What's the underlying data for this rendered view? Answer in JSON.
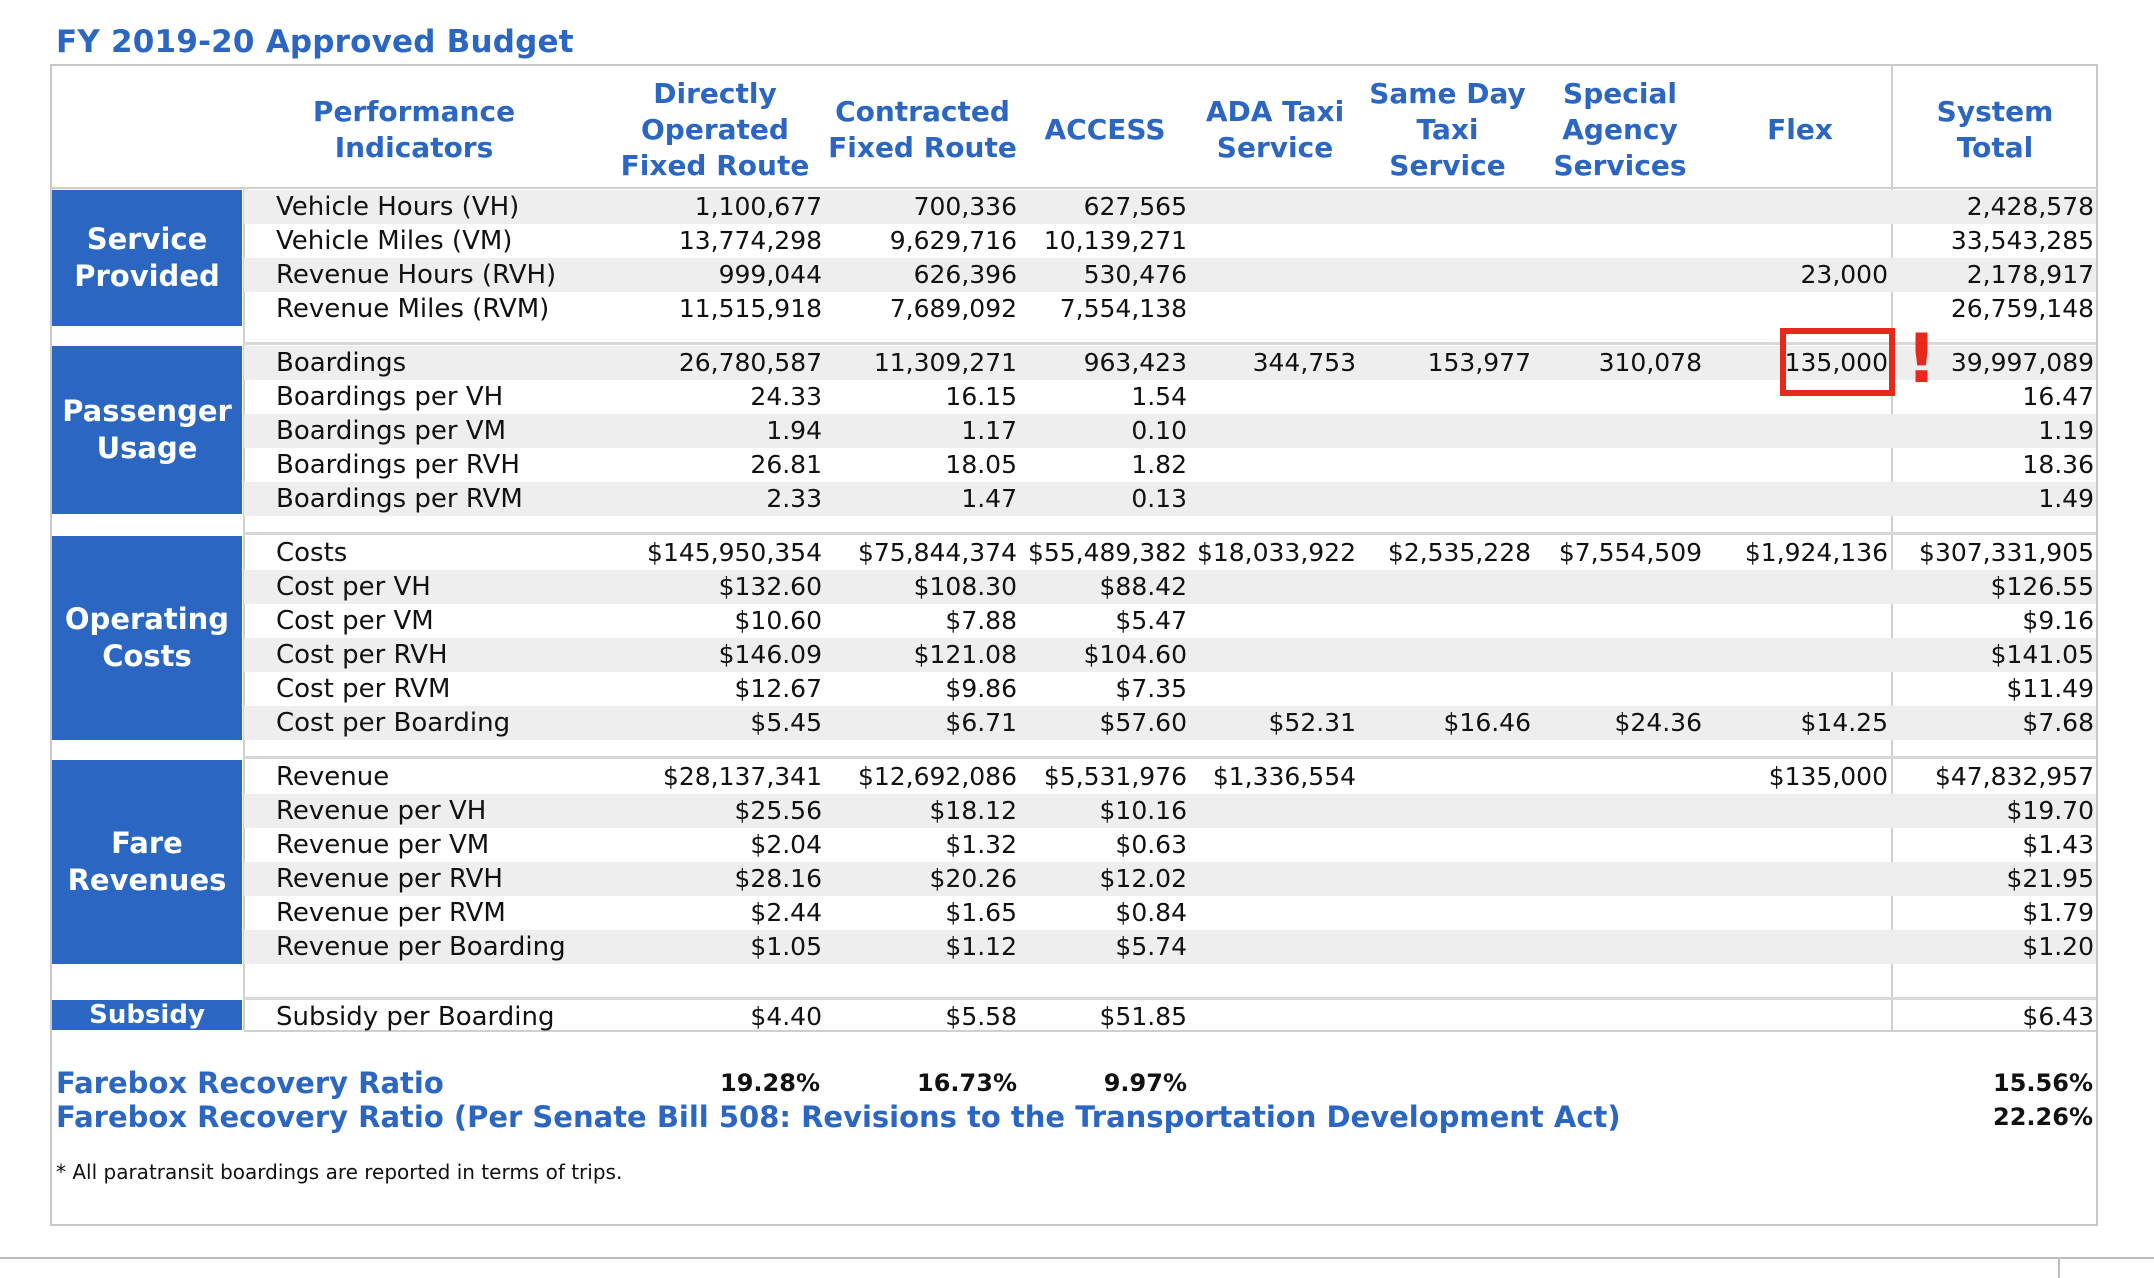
{
  "title": "FY 2019-20 Approved Budget",
  "headers": {
    "performance": "Performance Indicators",
    "direct": "Directly\nOperated\nFixed Route",
    "contracted": "Contracted\nFixed Route",
    "access": "ACCESS",
    "ada": "ADA Taxi\nService",
    "sameday": "Same Day\nTaxi\nService",
    "special": "Special\nAgency\nServices",
    "flex": "Flex",
    "total": "System Total"
  },
  "sections": {
    "service": "Service\nProvided",
    "passenger": "Passenger\nUsage",
    "operating": "Operating\nCosts",
    "fare": "Fare\nRevenues",
    "subsidy": "Subsidy"
  },
  "rows": [
    {
      "label": "Vehicle Hours (VH)",
      "direct": "1,100,677",
      "contracted": "700,336",
      "access": "627,565",
      "ada": "",
      "sameday": "",
      "special": "",
      "flex": "",
      "total": "2,428,578"
    },
    {
      "label": "Vehicle Miles (VM)",
      "direct": "13,774,298",
      "contracted": "9,629,716",
      "access": "10,139,271",
      "ada": "",
      "sameday": "",
      "special": "",
      "flex": "",
      "total": "33,543,285"
    },
    {
      "label": "Revenue Hours (RVH)",
      "direct": "999,044",
      "contracted": "626,396",
      "access": "530,476",
      "ada": "",
      "sameday": "",
      "special": "",
      "flex": "23,000",
      "total": "2,178,917"
    },
    {
      "label": "Revenue Miles (RVM)",
      "direct": "11,515,918",
      "contracted": "7,689,092",
      "access": "7,554,138",
      "ada": "",
      "sameday": "",
      "special": "",
      "flex": "",
      "total": "26,759,148"
    },
    {
      "label": "Boardings",
      "direct": "26,780,587",
      "contracted": "11,309,271",
      "access": "963,423",
      "ada": "344,753",
      "sameday": "153,977",
      "special": "310,078",
      "flex": "135,000",
      "total": "39,997,089"
    },
    {
      "label": "Boardings per VH",
      "direct": "24.33",
      "contracted": "16.15",
      "access": "1.54",
      "ada": "",
      "sameday": "",
      "special": "",
      "flex": "",
      "total": "16.47"
    },
    {
      "label": "Boardings per VM",
      "direct": "1.94",
      "contracted": "1.17",
      "access": "0.10",
      "ada": "",
      "sameday": "",
      "special": "",
      "flex": "",
      "total": "1.19"
    },
    {
      "label": "Boardings per RVH",
      "direct": "26.81",
      "contracted": "18.05",
      "access": "1.82",
      "ada": "",
      "sameday": "",
      "special": "",
      "flex": "",
      "total": "18.36"
    },
    {
      "label": "Boardings per RVM",
      "direct": "2.33",
      "contracted": "1.47",
      "access": "0.13",
      "ada": "",
      "sameday": "",
      "special": "",
      "flex": "",
      "total": "1.49"
    },
    {
      "label": "Costs",
      "direct": "$145,950,354",
      "contracted": "$75,844,374",
      "access": "$55,489,382",
      "ada": "$18,033,922",
      "sameday": "$2,535,228",
      "special": "$7,554,509",
      "flex": "$1,924,136",
      "total": "$307,331,905"
    },
    {
      "label": "Cost per VH",
      "direct": "$132.60",
      "contracted": "$108.30",
      "access": "$88.42",
      "ada": "",
      "sameday": "",
      "special": "",
      "flex": "",
      "total": "$126.55"
    },
    {
      "label": "Cost per VM",
      "direct": "$10.60",
      "contracted": "$7.88",
      "access": "$5.47",
      "ada": "",
      "sameday": "",
      "special": "",
      "flex": "",
      "total": "$9.16"
    },
    {
      "label": "Cost per RVH",
      "direct": "$146.09",
      "contracted": "$121.08",
      "access": "$104.60",
      "ada": "",
      "sameday": "",
      "special": "",
      "flex": "",
      "total": "$141.05"
    },
    {
      "label": "Cost per RVM",
      "direct": "$12.67",
      "contracted": "$9.86",
      "access": "$7.35",
      "ada": "",
      "sameday": "",
      "special": "",
      "flex": "",
      "total": "$11.49"
    },
    {
      "label": "Cost per Boarding",
      "direct": "$5.45",
      "contracted": "$6.71",
      "access": "$57.60",
      "ada": "$52.31",
      "sameday": "$16.46",
      "special": "$24.36",
      "flex": "$14.25",
      "total": "$7.68"
    },
    {
      "label": "Revenue",
      "direct": "$28,137,341",
      "contracted": "$12,692,086",
      "access": "$5,531,976",
      "ada": "$1,336,554",
      "sameday": "",
      "special": "",
      "flex": "$135,000",
      "total": "$47,832,957"
    },
    {
      "label": "Revenue per VH",
      "direct": "$25.56",
      "contracted": "$18.12",
      "access": "$10.16",
      "ada": "",
      "sameday": "",
      "special": "",
      "flex": "",
      "total": "$19.70"
    },
    {
      "label": "Revenue per VM",
      "direct": "$2.04",
      "contracted": "$1.32",
      "access": "$0.63",
      "ada": "",
      "sameday": "",
      "special": "",
      "flex": "",
      "total": "$1.43"
    },
    {
      "label": "Revenue per RVH",
      "direct": "$28.16",
      "contracted": "$20.26",
      "access": "$12.02",
      "ada": "",
      "sameday": "",
      "special": "",
      "flex": "",
      "total": "$21.95"
    },
    {
      "label": "Revenue per RVM",
      "direct": "$2.44",
      "contracted": "$1.65",
      "access": "$0.84",
      "ada": "",
      "sameday": "",
      "special": "",
      "flex": "",
      "total": "$1.79"
    },
    {
      "label": "Revenue per Boarding",
      "direct": "$1.05",
      "contracted": "$1.12",
      "access": "$5.74",
      "ada": "",
      "sameday": "",
      "special": "",
      "flex": "",
      "total": "$1.20"
    },
    {
      "label": "Subsidy per Boarding",
      "direct": "$4.40",
      "contracted": "$5.58",
      "access": "$51.85",
      "ada": "",
      "sameday": "",
      "special": "",
      "flex": "",
      "total": "$6.43"
    }
  ],
  "farebox": {
    "label1": "Farebox Recovery Ratio",
    "direct1": "19.28%",
    "contracted1": "16.73%",
    "access1": "9.97%",
    "total1": "15.56%",
    "label2": "Farebox Recovery Ratio (Per Senate Bill 508: Revisions to the Transportation Development Act)",
    "total2": "22.26%"
  },
  "footnote": "* All paratransit boardings are reported in terms of trips.",
  "annotation": {
    "mark": "!",
    "color": "#e8281a"
  },
  "colors": {
    "accent": "#2a66c2",
    "stripe": "#eeeeee",
    "highlight": "#e8281a"
  }
}
